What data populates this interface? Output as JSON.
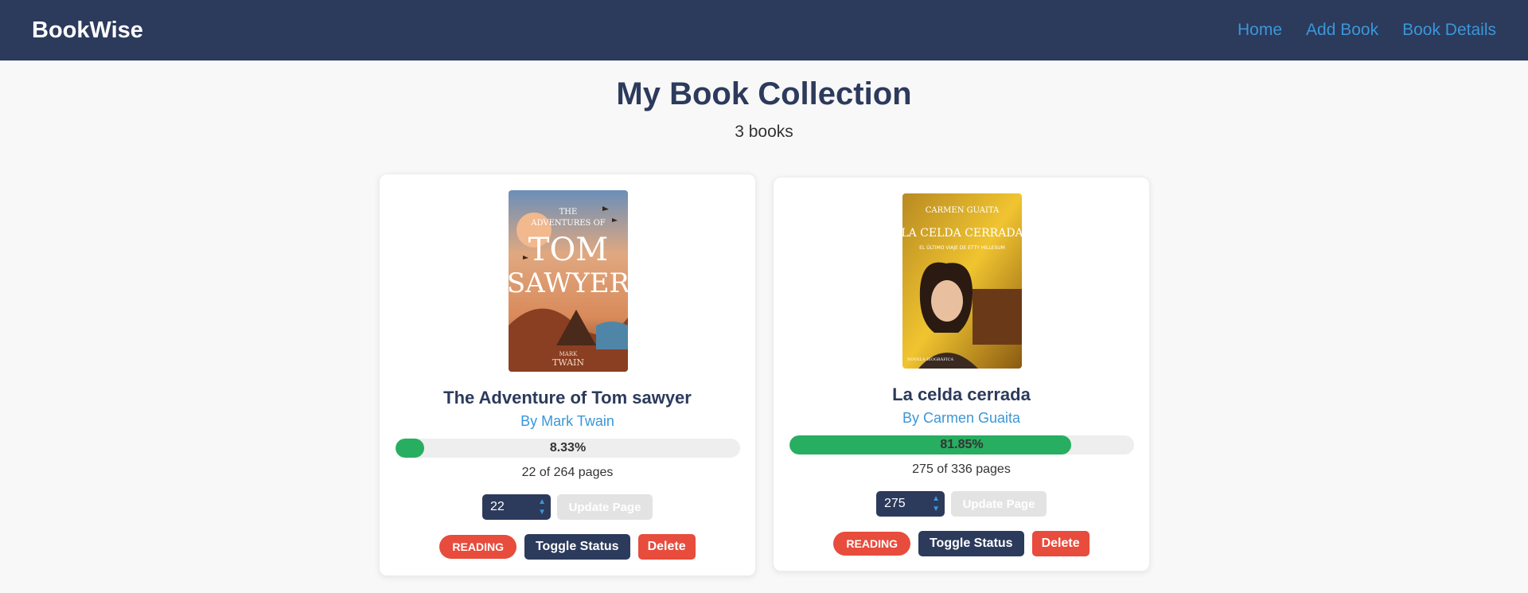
{
  "nav": {
    "brand": "BookWise",
    "links": [
      "Home",
      "Add Book",
      "Book Details"
    ]
  },
  "header": {
    "title": "My Book Collection",
    "count": "3 books"
  },
  "books": [
    {
      "cover_lines": [
        "THE",
        "ADVENTURES OF",
        "TOM",
        "SAWYER",
        "MARK",
        "TWAIN"
      ],
      "title": "The Adventure of Tom sawyer",
      "author": "By Mark Twain",
      "progress": 8.33,
      "progress_label": "8.33%",
      "pages": "22 of 264 pages",
      "page_value": "22",
      "update_label": "Update Page",
      "status": "READING",
      "toggle_label": "Toggle Status",
      "delete_label": "Delete"
    },
    {
      "cover_lines": [
        "CARMEN GUAITA",
        "LA CELDA CERRADA",
        "EL ÚLTIMO VIAJE DE ETTY HILLESUM",
        "NOVELA BIOGRÁFICA"
      ],
      "title": "La celda cerrada",
      "author": "By Carmen Guaita",
      "progress": 81.85,
      "progress_label": "81.85%",
      "pages": "275 of 336 pages",
      "page_value": "275",
      "update_label": "Update Page",
      "status": "READING",
      "toggle_label": "Toggle Status",
      "delete_label": "Delete"
    }
  ],
  "colors": {
    "navbar": "#2c3a5c",
    "link": "#3a97d8",
    "progress": "#27ae60",
    "danger": "#e74c3c"
  }
}
